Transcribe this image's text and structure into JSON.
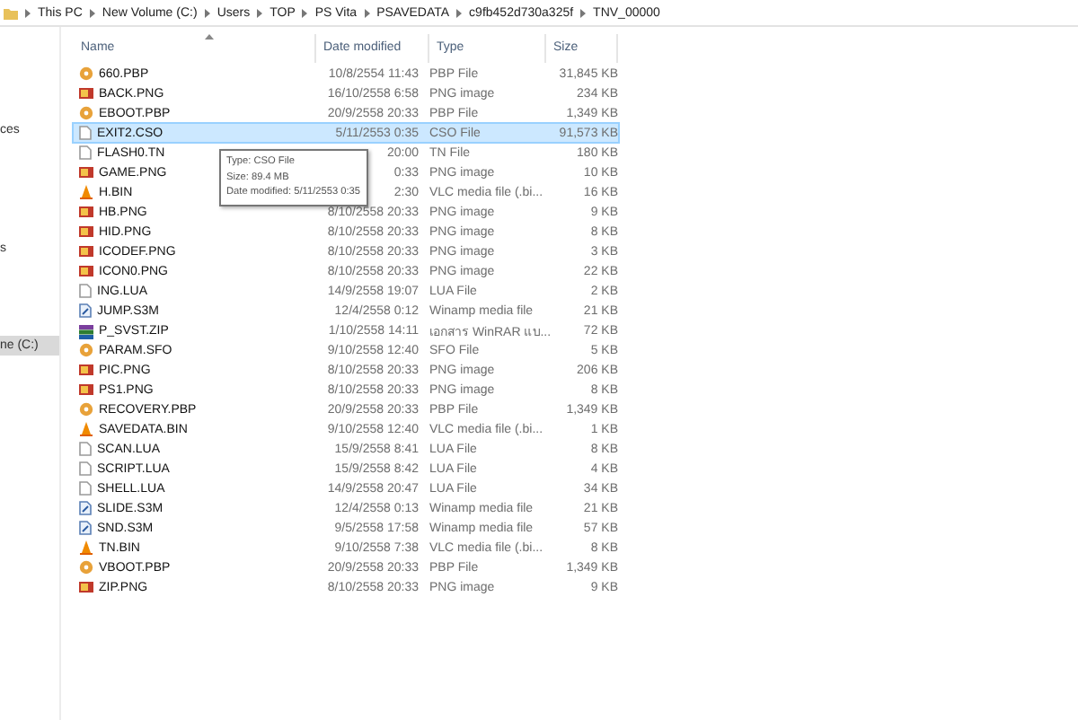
{
  "breadcrumb": [
    "This PC",
    "New Volume (C:)",
    "Users",
    "TOP",
    "PS Vita",
    "PSAVEDATA",
    "c9fb452d730a325f",
    "TNV_00000"
  ],
  "sidebar": {
    "items": [
      {
        "label": "ces",
        "selected": false
      },
      {
        "label": "s",
        "selected": false
      },
      {
        "label": "ne (C:)",
        "selected": true
      }
    ]
  },
  "columns": [
    "Name",
    "Date modified",
    "Type",
    "Size"
  ],
  "rows": [
    {
      "kind": "pbp",
      "name": "660.PBP",
      "date": "10/8/2554 11:43",
      "type": "PBP File",
      "size": "31,845 KB",
      "selected": false
    },
    {
      "kind": "png",
      "name": "BACK.PNG",
      "date": "16/10/2558 6:58",
      "type": "PNG image",
      "size": "234 KB",
      "selected": false
    },
    {
      "kind": "pbp",
      "name": "EBOOT.PBP",
      "date": "20/9/2558 20:33",
      "type": "PBP File",
      "size": "1,349 KB",
      "selected": false
    },
    {
      "kind": "file",
      "name": "EXIT2.CSO",
      "date": "5/11/2553 0:35",
      "type": "CSO File",
      "size": "91,573 KB",
      "selected": true
    },
    {
      "kind": "file",
      "name": "FLASH0.TN",
      "date": "20:00",
      "type": "TN File",
      "size": "180 KB",
      "selected": false
    },
    {
      "kind": "png",
      "name": "GAME.PNG",
      "date": "0:33",
      "type": "PNG image",
      "size": "10 KB",
      "selected": false
    },
    {
      "kind": "vlc",
      "name": "H.BIN",
      "date": "2:30",
      "type": "VLC media file (.bi...",
      "size": "16 KB",
      "selected": false
    },
    {
      "kind": "png",
      "name": "HB.PNG",
      "date": "8/10/2558 20:33",
      "type": "PNG image",
      "size": "9 KB",
      "selected": false
    },
    {
      "kind": "png",
      "name": "HID.PNG",
      "date": "8/10/2558 20:33",
      "type": "PNG image",
      "size": "8 KB",
      "selected": false
    },
    {
      "kind": "png",
      "name": "ICODEF.PNG",
      "date": "8/10/2558 20:33",
      "type": "PNG image",
      "size": "3 KB",
      "selected": false
    },
    {
      "kind": "png",
      "name": "ICON0.PNG",
      "date": "8/10/2558 20:33",
      "type": "PNG image",
      "size": "22 KB",
      "selected": false
    },
    {
      "kind": "file",
      "name": "ING.LUA",
      "date": "14/9/2558 19:07",
      "type": "LUA File",
      "size": "2 KB",
      "selected": false
    },
    {
      "kind": "s3m",
      "name": "JUMP.S3M",
      "date": "12/4/2558 0:12",
      "type": "Winamp media file",
      "size": "21 KB",
      "selected": false
    },
    {
      "kind": "zip",
      "name": "P_SVST.ZIP",
      "date": "1/10/2558 14:11",
      "type": "เอกสาร WinRAR แบ...",
      "size": "72 KB",
      "selected": false
    },
    {
      "kind": "pbp",
      "name": "PARAM.SFO",
      "date": "9/10/2558 12:40",
      "type": "SFO File",
      "size": "5 KB",
      "selected": false
    },
    {
      "kind": "png",
      "name": "PIC.PNG",
      "date": "8/10/2558 20:33",
      "type": "PNG image",
      "size": "206 KB",
      "selected": false
    },
    {
      "kind": "png",
      "name": "PS1.PNG",
      "date": "8/10/2558 20:33",
      "type": "PNG image",
      "size": "8 KB",
      "selected": false
    },
    {
      "kind": "pbp",
      "name": "RECOVERY.PBP",
      "date": "20/9/2558 20:33",
      "type": "PBP File",
      "size": "1,349 KB",
      "selected": false
    },
    {
      "kind": "vlc",
      "name": "SAVEDATA.BIN",
      "date": "9/10/2558 12:40",
      "type": "VLC media file (.bi...",
      "size": "1 KB",
      "selected": false
    },
    {
      "kind": "file",
      "name": "SCAN.LUA",
      "date": "15/9/2558 8:41",
      "type": "LUA File",
      "size": "8 KB",
      "selected": false
    },
    {
      "kind": "file",
      "name": "SCRIPT.LUA",
      "date": "15/9/2558 8:42",
      "type": "LUA File",
      "size": "4 KB",
      "selected": false
    },
    {
      "kind": "file",
      "name": "SHELL.LUA",
      "date": "14/9/2558 20:47",
      "type": "LUA File",
      "size": "34 KB",
      "selected": false
    },
    {
      "kind": "s3m",
      "name": "SLIDE.S3M",
      "date": "12/4/2558 0:13",
      "type": "Winamp media file",
      "size": "21 KB",
      "selected": false
    },
    {
      "kind": "s3m",
      "name": "SND.S3M",
      "date": "9/5/2558 17:58",
      "type": "Winamp media file",
      "size": "57 KB",
      "selected": false
    },
    {
      "kind": "vlc",
      "name": "TN.BIN",
      "date": "9/10/2558 7:38",
      "type": "VLC media file (.bi...",
      "size": "8 KB",
      "selected": false
    },
    {
      "kind": "pbp",
      "name": "VBOOT.PBP",
      "date": "20/9/2558 20:33",
      "type": "PBP File",
      "size": "1,349 KB",
      "selected": false
    },
    {
      "kind": "png",
      "name": "ZIP.PNG",
      "date": "8/10/2558 20:33",
      "type": "PNG image",
      "size": "9 KB",
      "selected": false
    }
  ],
  "tooltip": [
    "Type: CSO File",
    "Size: 89.4 MB",
    "Date modified: 5/11/2553 0:35"
  ]
}
